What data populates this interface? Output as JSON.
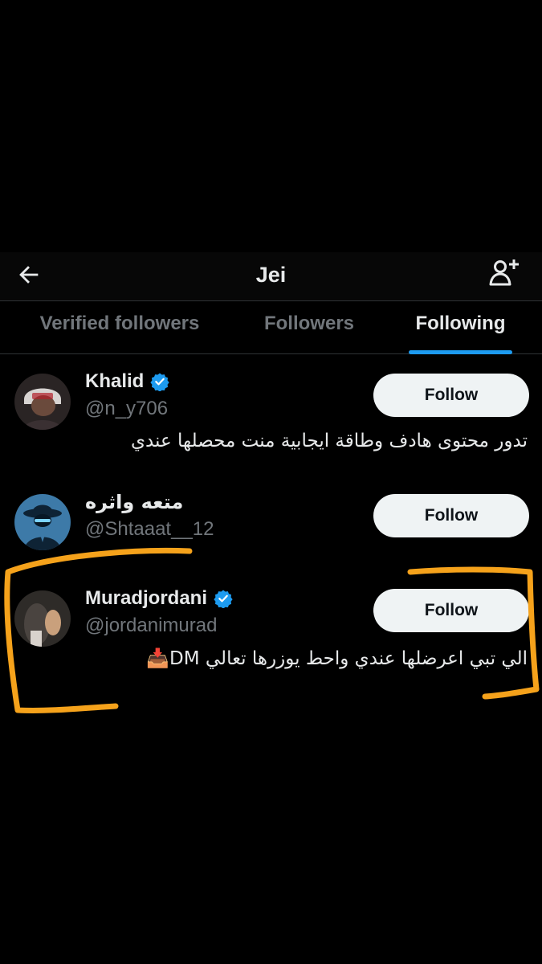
{
  "header": {
    "title": "Jei",
    "back_icon": "arrow-left-icon",
    "add_icon": "person-add-icon"
  },
  "tabs": [
    {
      "label": "Verified followers",
      "active": false
    },
    {
      "label": "Followers",
      "active": false
    },
    {
      "label": "Following",
      "active": true
    }
  ],
  "users": [
    {
      "name": "Khalid",
      "handle": "@n_y706",
      "verified": true,
      "bio": "تدور محتوى هادف وطاقة ايجابية منت محصلها عندي",
      "follow_label": "Follow"
    },
    {
      "name": "متعه واثره",
      "handle": "@Shtaaat__12",
      "verified": false,
      "bio": "",
      "follow_label": "Follow"
    },
    {
      "name": "Muradjordani",
      "handle": "@jordanimurad",
      "verified": true,
      "bio": "الي تبي اعرضلها عندي واحط يوزرها تعالي DM📥",
      "follow_label": "Follow"
    }
  ],
  "colors": {
    "accent": "#1d9bf0",
    "annotation": "#f5a21b",
    "button_bg": "#eff3f4"
  }
}
